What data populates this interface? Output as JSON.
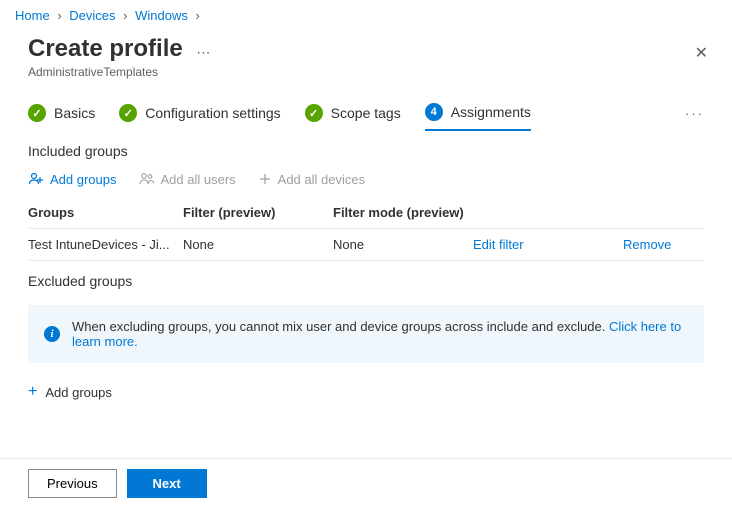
{
  "breadcrumb": {
    "home": "Home",
    "devices": "Devices",
    "windows": "Windows"
  },
  "header": {
    "title": "Create profile",
    "subtitle": "AdministrativeTemplates"
  },
  "tabs": {
    "basics": "Basics",
    "config": "Configuration settings",
    "scope": "Scope tags",
    "assign_num": "4",
    "assign": "Assignments"
  },
  "included": {
    "heading": "Included groups",
    "add_groups": "Add groups",
    "add_users": "Add all users",
    "add_devices": "Add all devices",
    "cols": {
      "groups": "Groups",
      "filter": "Filter (preview)",
      "mode": "Filter mode (preview)"
    },
    "row": {
      "group": "Test IntuneDevices - Ji...",
      "filter": "None",
      "mode": "None",
      "edit": "Edit filter",
      "remove": "Remove"
    }
  },
  "excluded": {
    "heading": "Excluded groups",
    "info_text": "When excluding groups, you cannot mix user and device groups across include and exclude. ",
    "info_link": "Click here to learn more.",
    "add_groups": "Add groups"
  },
  "footer": {
    "previous": "Previous",
    "next": "Next"
  }
}
